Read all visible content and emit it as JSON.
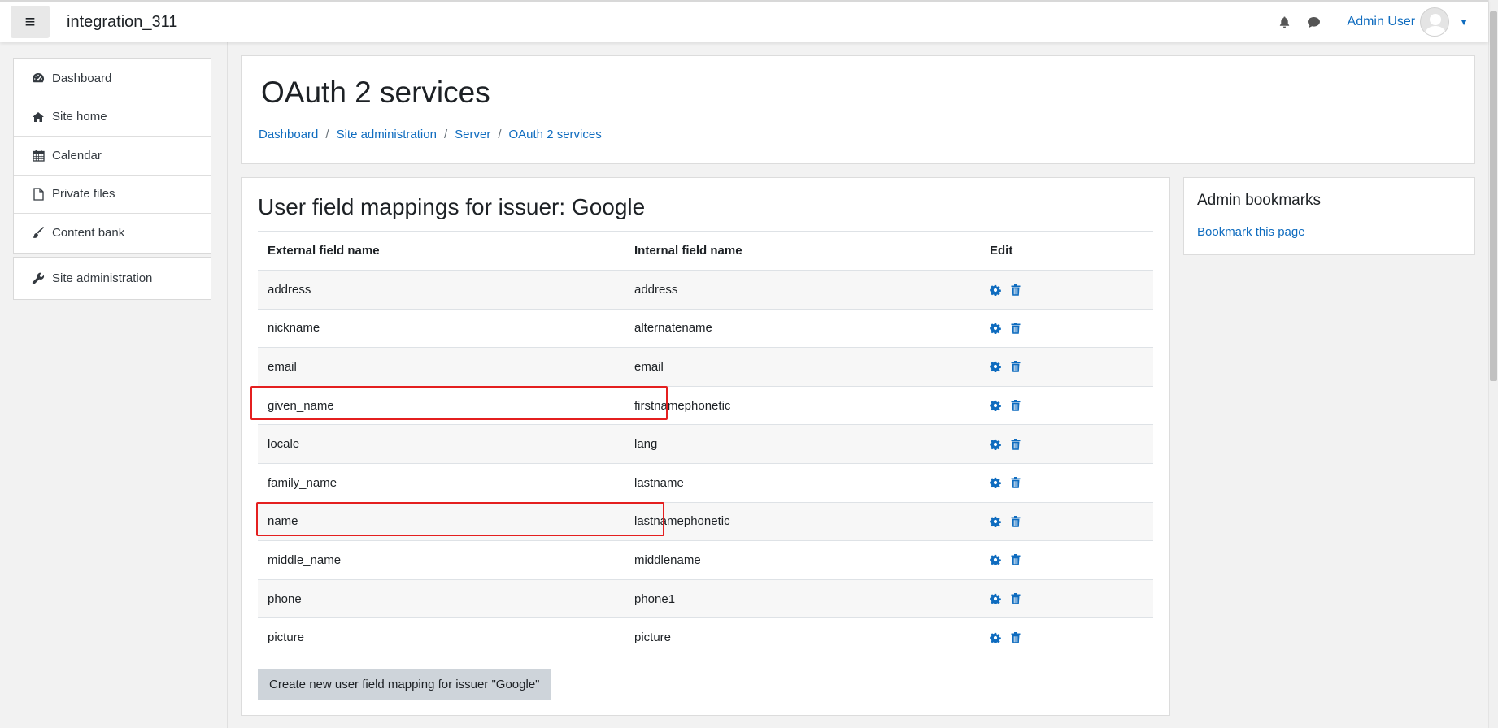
{
  "navbar": {
    "site_name": "integration_311",
    "user_name": "Admin User",
    "icons": [
      "menu-icon",
      "bell-icon",
      "chat-icon",
      "avatar",
      "caret-down-icon"
    ]
  },
  "drawer": {
    "items": [
      {
        "label": "Dashboard",
        "icon": "dashboard-icon"
      },
      {
        "label": "Site home",
        "icon": "home-icon"
      },
      {
        "label": "Calendar",
        "icon": "calendar-icon"
      },
      {
        "label": "Private files",
        "icon": "file-icon"
      },
      {
        "label": "Content bank",
        "icon": "brush-icon"
      }
    ],
    "admin_item": {
      "label": "Site administration",
      "icon": "wrench-icon"
    }
  },
  "header": {
    "title": "OAuth 2 services",
    "breadcrumb": [
      "Dashboard",
      "Site administration",
      "Server",
      "OAuth 2 services"
    ]
  },
  "main": {
    "title": "User field mappings for issuer: Google",
    "columns": [
      "External field name",
      "Internal field name",
      "Edit"
    ],
    "rows": [
      {
        "external": "address",
        "internal": "address"
      },
      {
        "external": "nickname",
        "internal": "alternatename"
      },
      {
        "external": "email",
        "internal": "email"
      },
      {
        "external": "given_name",
        "internal": "firstnamephonetic"
      },
      {
        "external": "locale",
        "internal": "lang"
      },
      {
        "external": "family_name",
        "internal": "lastname"
      },
      {
        "external": "name",
        "internal": "lastnamephonetic"
      },
      {
        "external": "middle_name",
        "internal": "middlename"
      },
      {
        "external": "phone",
        "internal": "phone1"
      },
      {
        "external": "picture",
        "internal": "picture"
      }
    ],
    "create_button": "Create new user field mapping for issuer \"Google\""
  },
  "bookmarks": {
    "title": "Admin bookmarks",
    "link": "Bookmark this page"
  },
  "colors": {
    "link": "#0f6cbf",
    "highlight": "#e41f1f"
  }
}
